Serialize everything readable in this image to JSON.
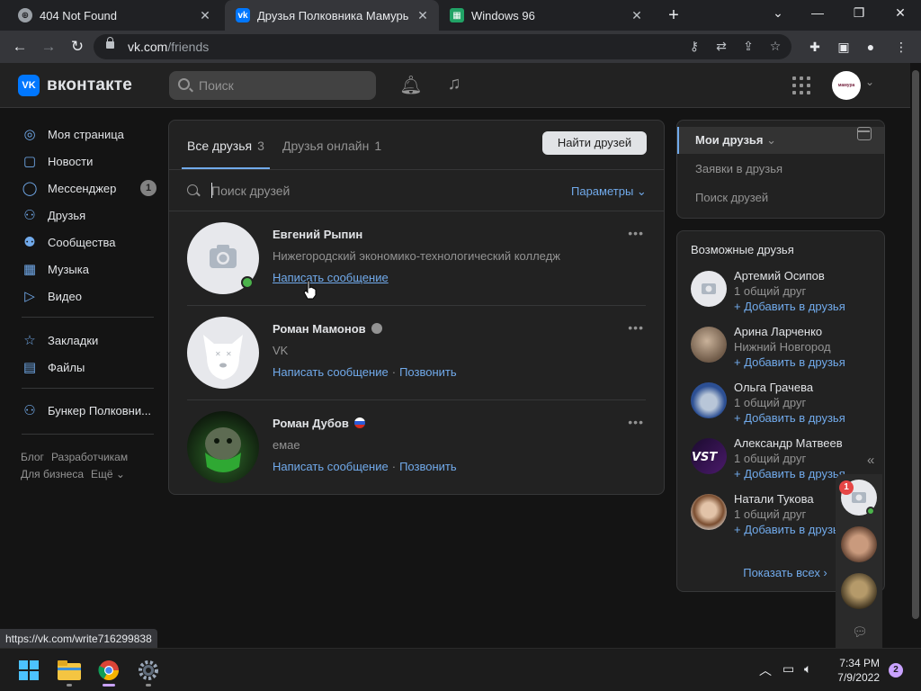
{
  "browser": {
    "tabs": [
      {
        "title": "404 Not Found"
      },
      {
        "title": "Друзья Полковника Мамуры – "
      },
      {
        "title": "Windows 96"
      }
    ],
    "url_host": "vk.com",
    "url_path": "/friends",
    "status_url": "https://vk.com/write716299838"
  },
  "vk": {
    "brand": "вконтакте",
    "logo_text": "VK",
    "search_placeholder": "Поиск",
    "avatar_text": "мамура"
  },
  "sidebar": {
    "items": [
      {
        "label": "Моя страница",
        "icon": "user-circle-icon"
      },
      {
        "label": "Новости",
        "icon": "news-icon"
      },
      {
        "label": "Мессенджер",
        "icon": "message-icon",
        "badge": "1"
      },
      {
        "label": "Друзья",
        "icon": "friends-icon"
      },
      {
        "label": "Сообщества",
        "icon": "communities-icon"
      },
      {
        "label": "Музыка",
        "icon": "music-icon"
      },
      {
        "label": "Видео",
        "icon": "video-icon"
      },
      {
        "label": "Закладки",
        "icon": "bookmark-icon"
      },
      {
        "label": "Файлы",
        "icon": "files-icon"
      },
      {
        "label": "Бункер Полковни...",
        "icon": "group-icon"
      }
    ],
    "footer": [
      "Блог",
      "Разработчикам",
      "Для бизнеса",
      "Ещё ⌄"
    ]
  },
  "friends_panel": {
    "tabs": [
      {
        "label": "Все друзья",
        "count": "3"
      },
      {
        "label": "Друзья онлайн",
        "count": "1"
      }
    ],
    "find_button": "Найти друзей",
    "search_placeholder": "Поиск друзей",
    "params_label": "Параметры",
    "friends": [
      {
        "name": "Евгений Рыпин",
        "sub": "Нижегородский экономико-технологический колледж",
        "action1": "Написать сообщение",
        "action2": ""
      },
      {
        "name": "Роман Мамонов",
        "sub": "VK",
        "action1": "Написать сообщение",
        "action2": "Позвонить"
      },
      {
        "name": "Роман Дубов",
        "sub": "емае",
        "action1": "Написать сообщение",
        "action2": "Позвонить"
      }
    ]
  },
  "right_menu": {
    "items": [
      "Мои друзья",
      "Заявки в друзья",
      "Поиск друзей"
    ]
  },
  "possible_friends": {
    "title": "Возможные друзья",
    "add_label": "+ Добавить в друзья",
    "people": [
      {
        "name": "Артемий Осипов",
        "sub": "1 общий друг"
      },
      {
        "name": "Арина Ларченко",
        "sub": "Нижний Новгород"
      },
      {
        "name": "Ольга Грачева",
        "sub": "1 общий друг"
      },
      {
        "name": "Александр Матвеев",
        "sub": "1 общий друг"
      },
      {
        "name": "Натали Тукова",
        "sub": "1 общий друг"
      }
    ],
    "show_all": "Показать всех ›"
  },
  "chat": {
    "badge": "1"
  },
  "taskbar": {
    "time": "7:34 PM",
    "date": "7/9/2022",
    "notifications": "2"
  }
}
